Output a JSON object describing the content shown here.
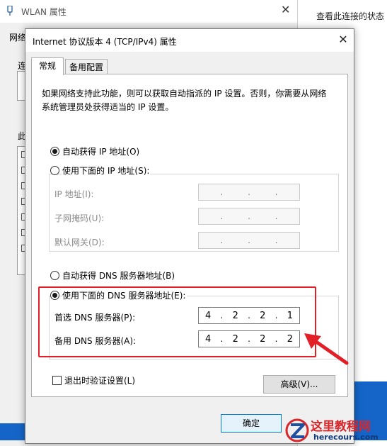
{
  "background_window": {
    "title": "WLAN 属性",
    "label_network": "网络",
    "label_connect": "连",
    "label_this": "此",
    "right_link": "查看此连接的状态"
  },
  "dialog": {
    "title": "Internet 协议版本 4 (TCP/IPv4) 属性",
    "tabs": [
      {
        "label": "常规",
        "selected": true
      },
      {
        "label": "备用配置",
        "selected": false
      }
    ],
    "description": "如果网络支持此功能，则可以获取自动指派的 IP 设置。否则，你需要从网络系统管理员处获得适当的 IP 设置。",
    "ip": {
      "auto_label": "自动获得 IP 地址(O)",
      "auto_selected": true,
      "manual_label": "使用下面的 IP 地址(S):",
      "fields": [
        {
          "label": "IP 地址(I):",
          "value": ". . ."
        },
        {
          "label": "子网掩码(U):",
          "value": ". . ."
        },
        {
          "label": "默认网关(D):",
          "value": ". . ."
        }
      ]
    },
    "dns": {
      "auto_label": "自动获得 DNS 服务器地址(B)",
      "manual_label": "使用下面的 DNS 服务器地址(E):",
      "manual_selected": true,
      "preferred_label": "首选 DNS 服务器(P):",
      "preferred": [
        "4",
        "2",
        "2",
        "1"
      ],
      "alternate_label": "备用 DNS 服务器(A):",
      "alternate": [
        "4",
        "2",
        "2",
        "2"
      ]
    },
    "validate_label": "退出时验证设置(L)",
    "validate_checked": false,
    "advanced_button": "高级(V)...",
    "ok_button": "确定"
  },
  "watermark": {
    "title": "这里教程网",
    "url": "herecours.com"
  },
  "colors": {
    "highlight": "#e21f26",
    "accent": "#0078d7"
  }
}
